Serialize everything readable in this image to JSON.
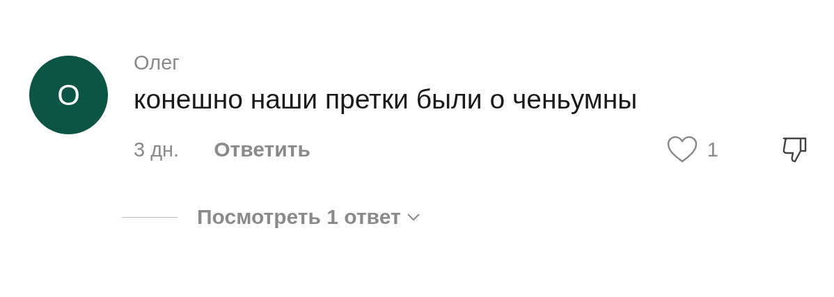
{
  "comment": {
    "avatar_letter": "О",
    "color": "#0c5443",
    "author": "Олег",
    "text": "конешно наши претки были о ченьумны",
    "time": "3 дн.",
    "reply_label": "Ответить",
    "likes": "1",
    "liked": false
  },
  "replies": {
    "label": "Посмотреть 1 ответ"
  }
}
